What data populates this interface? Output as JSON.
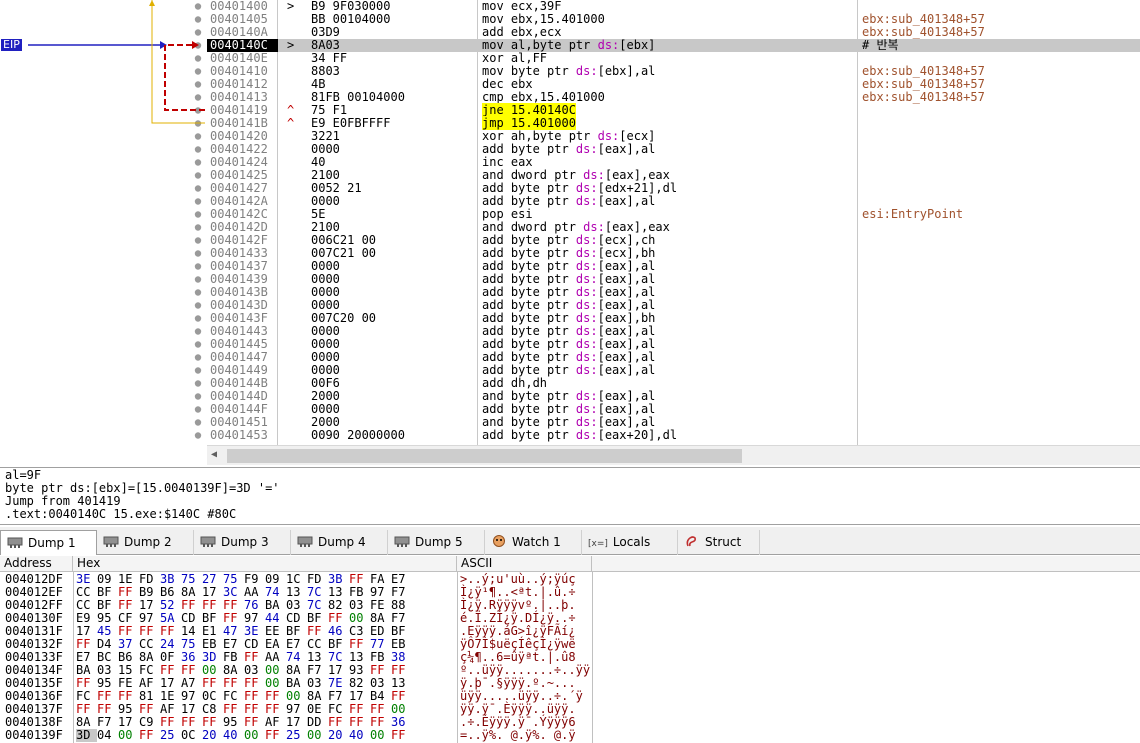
{
  "eip_label": "EIP",
  "disasm_rows": [
    {
      "addr": "00401400",
      "mark": ">",
      "bytes": "B9 9F030000",
      "instr": [
        {
          "t": "mov ecx,39F"
        }
      ],
      "comment": ""
    },
    {
      "addr": "00401405",
      "mark": "",
      "bytes": "BB 00104000",
      "instr": [
        {
          "t": "mov ebx,15.401000"
        }
      ],
      "comment": "ebx:sub_401348+57"
    },
    {
      "addr": "0040140A",
      "mark": "",
      "bytes": "03D9",
      "instr": [
        {
          "t": "add ebx,ecx"
        }
      ],
      "comment": "ebx:sub_401348+57"
    },
    {
      "addr": "0040140C",
      "mark": ">",
      "bytes": "8A03",
      "instr": [
        {
          "t": "mov al,byte ptr "
        },
        {
          "t": "ds:",
          "c": "seg"
        },
        {
          "t": "[ebx]"
        }
      ],
      "comment": "# 반복",
      "current": true
    },
    {
      "addr": "0040140E",
      "mark": "",
      "bytes": "34 FF",
      "instr": [
        {
          "t": "xor al,FF"
        }
      ],
      "comment": ""
    },
    {
      "addr": "00401410",
      "mark": "",
      "bytes": "8803",
      "instr": [
        {
          "t": "mov byte ptr "
        },
        {
          "t": "ds:",
          "c": "seg"
        },
        {
          "t": "[ebx],al"
        }
      ],
      "comment": "ebx:sub_401348+57"
    },
    {
      "addr": "00401412",
      "mark": "",
      "bytes": "4B",
      "instr": [
        {
          "t": "dec ebx"
        }
      ],
      "comment": "ebx:sub_401348+57"
    },
    {
      "addr": "00401413",
      "mark": "",
      "bytes": "81FB 00104000",
      "instr": [
        {
          "t": "cmp ebx,15.401000"
        }
      ],
      "comment": "ebx:sub_401348+57"
    },
    {
      "addr": "00401419",
      "mark": "^",
      "markUp": true,
      "bytes": "75 F1",
      "instr": [
        {
          "t": "jne 15.40140C",
          "c": "hl"
        }
      ],
      "comment": ""
    },
    {
      "addr": "0040141B",
      "mark": "^",
      "markUp": true,
      "bytes": "E9 E0FBFFFF",
      "instr": [
        {
          "t": "jmp 15.401000",
          "c": "hl"
        }
      ],
      "comment": ""
    },
    {
      "addr": "00401420",
      "mark": "",
      "bytes": "3221",
      "instr": [
        {
          "t": "xor ah,byte ptr "
        },
        {
          "t": "ds:",
          "c": "seg"
        },
        {
          "t": "[ecx]"
        }
      ],
      "comment": ""
    },
    {
      "addr": "00401422",
      "mark": "",
      "bytes": "0000",
      "instr": [
        {
          "t": "add byte ptr "
        },
        {
          "t": "ds:",
          "c": "seg"
        },
        {
          "t": "[eax],al"
        }
      ],
      "comment": ""
    },
    {
      "addr": "00401424",
      "mark": "",
      "bytes": "40",
      "instr": [
        {
          "t": "inc eax"
        }
      ],
      "comment": ""
    },
    {
      "addr": "00401425",
      "mark": "",
      "bytes": "2100",
      "instr": [
        {
          "t": "and dword ptr "
        },
        {
          "t": "ds:",
          "c": "seg"
        },
        {
          "t": "[eax],eax"
        }
      ],
      "comment": ""
    },
    {
      "addr": "00401427",
      "mark": "",
      "bytes": "0052 21",
      "instr": [
        {
          "t": "add byte ptr "
        },
        {
          "t": "ds:",
          "c": "seg"
        },
        {
          "t": "[edx+21],dl"
        }
      ],
      "comment": ""
    },
    {
      "addr": "0040142A",
      "mark": "",
      "bytes": "0000",
      "instr": [
        {
          "t": "add byte ptr "
        },
        {
          "t": "ds:",
          "c": "seg"
        },
        {
          "t": "[eax],al"
        }
      ],
      "comment": ""
    },
    {
      "addr": "0040142C",
      "mark": "",
      "bytes": "5E",
      "instr": [
        {
          "t": "pop esi"
        }
      ],
      "comment": "esi:EntryPoint"
    },
    {
      "addr": "0040142D",
      "mark": "",
      "bytes": "2100",
      "instr": [
        {
          "t": "and dword ptr "
        },
        {
          "t": "ds:",
          "c": "seg"
        },
        {
          "t": "[eax],eax"
        }
      ],
      "comment": ""
    },
    {
      "addr": "0040142F",
      "mark": "",
      "bytes": "006C21 00",
      "instr": [
        {
          "t": "add byte ptr "
        },
        {
          "t": "ds:",
          "c": "seg"
        },
        {
          "t": "[ecx],ch"
        }
      ],
      "comment": ""
    },
    {
      "addr": "00401433",
      "mark": "",
      "bytes": "007C21 00",
      "instr": [
        {
          "t": "add byte ptr "
        },
        {
          "t": "ds:",
          "c": "seg"
        },
        {
          "t": "[ecx],bh"
        }
      ],
      "comment": ""
    },
    {
      "addr": "00401437",
      "mark": "",
      "bytes": "0000",
      "instr": [
        {
          "t": "add byte ptr "
        },
        {
          "t": "ds:",
          "c": "seg"
        },
        {
          "t": "[eax],al"
        }
      ],
      "comment": ""
    },
    {
      "addr": "00401439",
      "mark": "",
      "bytes": "0000",
      "instr": [
        {
          "t": "add byte ptr "
        },
        {
          "t": "ds:",
          "c": "seg"
        },
        {
          "t": "[eax],al"
        }
      ],
      "comment": ""
    },
    {
      "addr": "0040143B",
      "mark": "",
      "bytes": "0000",
      "instr": [
        {
          "t": "add byte ptr "
        },
        {
          "t": "ds:",
          "c": "seg"
        },
        {
          "t": "[eax],al"
        }
      ],
      "comment": ""
    },
    {
      "addr": "0040143D",
      "mark": "",
      "bytes": "0000",
      "instr": [
        {
          "t": "add byte ptr "
        },
        {
          "t": "ds:",
          "c": "seg"
        },
        {
          "t": "[eax],al"
        }
      ],
      "comment": ""
    },
    {
      "addr": "0040143F",
      "mark": "",
      "bytes": "007C20 00",
      "instr": [
        {
          "t": "add byte ptr "
        },
        {
          "t": "ds:",
          "c": "seg"
        },
        {
          "t": "[eax],bh"
        }
      ],
      "comment": ""
    },
    {
      "addr": "00401443",
      "mark": "",
      "bytes": "0000",
      "instr": [
        {
          "t": "add byte ptr "
        },
        {
          "t": "ds:",
          "c": "seg"
        },
        {
          "t": "[eax],al"
        }
      ],
      "comment": ""
    },
    {
      "addr": "00401445",
      "mark": "",
      "bytes": "0000",
      "instr": [
        {
          "t": "add byte ptr "
        },
        {
          "t": "ds:",
          "c": "seg"
        },
        {
          "t": "[eax],al"
        }
      ],
      "comment": ""
    },
    {
      "addr": "00401447",
      "mark": "",
      "bytes": "0000",
      "instr": [
        {
          "t": "add byte ptr "
        },
        {
          "t": "ds:",
          "c": "seg"
        },
        {
          "t": "[eax],al"
        }
      ],
      "comment": ""
    },
    {
      "addr": "00401449",
      "mark": "",
      "bytes": "0000",
      "instr": [
        {
          "t": "add byte ptr "
        },
        {
          "t": "ds:",
          "c": "seg"
        },
        {
          "t": "[eax],al"
        }
      ],
      "comment": ""
    },
    {
      "addr": "0040144B",
      "mark": "",
      "bytes": "00F6",
      "instr": [
        {
          "t": "add dh,dh"
        }
      ],
      "comment": ""
    },
    {
      "addr": "0040144D",
      "mark": "",
      "bytes": "2000",
      "instr": [
        {
          "t": "and byte ptr "
        },
        {
          "t": "ds:",
          "c": "seg"
        },
        {
          "t": "[eax],al"
        }
      ],
      "comment": ""
    },
    {
      "addr": "0040144F",
      "mark": "",
      "bytes": "0000",
      "instr": [
        {
          "t": "add byte ptr "
        },
        {
          "t": "ds:",
          "c": "seg"
        },
        {
          "t": "[eax],al"
        }
      ],
      "comment": ""
    },
    {
      "addr": "00401451",
      "mark": "",
      "bytes": "2000",
      "instr": [
        {
          "t": "and byte ptr "
        },
        {
          "t": "ds:",
          "c": "seg"
        },
        {
          "t": "[eax],al"
        }
      ],
      "comment": ""
    },
    {
      "addr": "00401453",
      "mark": "",
      "bytes": "0090 20000000",
      "instr": [
        {
          "t": "add byte ptr "
        },
        {
          "t": "ds:",
          "c": "seg"
        },
        {
          "t": "[eax+20],dl"
        }
      ],
      "comment": ""
    }
  ],
  "info_lines": [
    "al=9F",
    "byte ptr ds:[ebx]=[15.0040139F]=3D '='",
    "Jump from 401419",
    ".text:0040140C 15.exe:$140C #80C"
  ],
  "tabs": [
    {
      "label": "Dump 1",
      "icon": "memory-chip-icon",
      "active": true
    },
    {
      "label": "Dump 2",
      "icon": "memory-chip-icon"
    },
    {
      "label": "Dump 3",
      "icon": "memory-chip-icon"
    },
    {
      "label": "Dump 4",
      "icon": "memory-chip-icon"
    },
    {
      "label": "Dump 5",
      "icon": "memory-chip-icon"
    },
    {
      "label": "Watch 1",
      "icon": "watch-icon"
    },
    {
      "label": "Locals",
      "icon": "locals-icon",
      "prefix": "[x=]"
    },
    {
      "label": "Struct",
      "icon": "struct-icon"
    }
  ],
  "dump_header": {
    "address": "Address",
    "hex": "Hex",
    "ascii": "ASCII"
  },
  "dump_rows": [
    {
      "addr": "004012DF",
      "hex": "3E 09 1E FD 3B 75 27 75 F9 09 1C FD 3B FF FA E7",
      "ascii": ">..ý;u'uù..ý;ÿúç"
    },
    {
      "addr": "004012EF",
      "hex": "CC BF FF B9 B6 8A 17 3C AA 74 13 7C 13 FB 97 F7",
      "ascii": "Ì¿ÿ¹¶..<ªt.|.û.÷"
    },
    {
      "addr": "004012FF",
      "hex": "CC BF FF 17 52 FF FF FF 76 BA 03 7C 82 03 FE 88",
      "ascii": "Ì¿ÿ.Rÿÿÿvº.|..þ."
    },
    {
      "addr": "0040130F",
      "hex": "E9 95 CF 97 5A CD BF FF 97 44 CD BF FF 00 8A F7",
      "ascii": "é.Ï.ZÍ¿ÿ.DÍ¿ÿ..÷"
    },
    {
      "addr": "0040131F",
      "hex": "17 45 FF FF FF 14 E1 47 3E EE BF FF 46 C3 ED BF",
      "ascii": ".Eÿÿÿ.áG>î¿ÿFÃí¿"
    },
    {
      "addr": "0040132F",
      "hex": "FF D4 37 CC 24 75 EB E7 CD EA E7 CC BF FF 77 EB",
      "ascii": "ÿÔ7Ì$uëçÍêçÌ¿ÿwë"
    },
    {
      "addr": "0040133F",
      "hex": "E7 BC B6 8A 0F 36 3D FB FF AA 74 13 7C 13 FB 38",
      "ascii": "ç¼¶..6=ûÿªt.|.û8"
    },
    {
      "addr": "0040134F",
      "hex": "BA 03 15 FC FF FF 00 8A 03 00 8A F7 17 93 FF FF",
      "ascii": "º..üÿÿ.......÷..ÿÿ"
    },
    {
      "addr": "0040135F",
      "hex": "FF 95 FE AF 17 A7 FF FF FF 00 BA 03 7E 82 03 13",
      "ascii": "ÿ.þ¯.§ÿÿÿ.º.~..."
    },
    {
      "addr": "0040136F",
      "hex": "FC FF FF 81 1E 97 0C FC FF FF 00 8A F7 17 B4 FF",
      "ascii": "üÿÿ.....üÿÿ..÷.´ÿ"
    },
    {
      "addr": "0040137F",
      "hex": "FF FF 95 FF AF 17 C8 FF FF FF 97 0E FC FF FF 00",
      "ascii": "ÿÿ.ÿ¯.Èÿÿÿ..üÿÿ."
    },
    {
      "addr": "0040138F",
      "hex": "8A F7 17 C9 FF FF FF 95 FF AF 17 DD FF FF FF 36",
      "ascii": ".÷.Éÿÿÿ.ÿ¯.Ýÿÿÿ6"
    },
    {
      "addr": "0040139F",
      "hex": "3D 04 00 FF 25 0C 20 40 00 FF 25 00 20 40 00 FF",
      "ascii": "=..ÿ%. @.ÿ%. @.ÿ"
    }
  ],
  "colors": {
    "accent": "#2020c0",
    "jump_arrow": "#c00000",
    "hex_red": "#c00000",
    "hex_blue": "#0000c0",
    "hex_green": "#008000",
    "highlight": "#ffff00"
  }
}
